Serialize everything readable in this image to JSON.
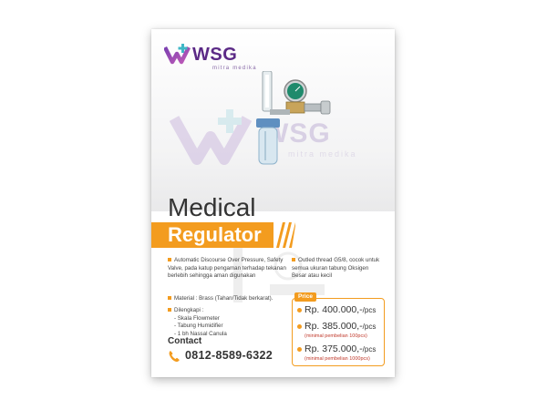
{
  "brand": {
    "name": "WSG",
    "tagline": "mitra medika",
    "purple": "#5b2a86",
    "accent": "#f39c1f"
  },
  "headline": {
    "title": "Medical",
    "subtitle": "Regulator"
  },
  "features_left": {
    "item1": "Automatic Discourse Over Pressure, Safety Valve, pada katup pengaman terhadap tekanan berlebih sehingga aman digunakan",
    "item2": "Material : Brass (Tahan/Tidak berkarat).",
    "item3_title": "Dilengkapi :",
    "item3_sub1": "- Skala Flowmeter",
    "item3_sub2": "- Tabung Humidifier",
    "item3_sub3": "- 1 bh Nassal Canula"
  },
  "features_right": {
    "item1": "Outled thread G5/8, cocok untuk semua ukuran tabung Oksigen Besar atau kecil"
  },
  "price": {
    "label": "Price",
    "p1": "Rp. 400.000,-",
    "p1_unit": "/pcs",
    "p2": "Rp. 385.000,-",
    "p2_unit": "/pcs",
    "p2_note": "(minimal pembelian 100pcs)",
    "p3": "Rp. 375.000,-",
    "p3_unit": "/pcs",
    "p3_note": "(minimal pembelian 1000pcs)"
  },
  "contact": {
    "title": "Contact",
    "phone": "0812-8589-6322"
  },
  "icons": [
    "logo-mark-icon",
    "phone-icon",
    "bullet-icon"
  ]
}
